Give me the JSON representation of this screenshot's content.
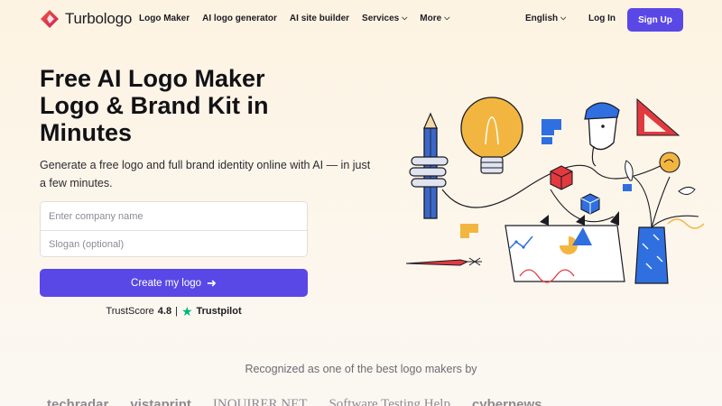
{
  "header": {
    "brand": "Turbologo",
    "nav": [
      {
        "label": "Logo Maker",
        "dropdown": false
      },
      {
        "label": "AI logo generator",
        "dropdown": false
      },
      {
        "label": "AI site builder",
        "dropdown": false
      },
      {
        "label": "Services",
        "dropdown": true
      },
      {
        "label": "More",
        "dropdown": true
      }
    ],
    "language": "English",
    "login": "Log In",
    "signup": "Sign Up"
  },
  "hero": {
    "title_lines": [
      "Free AI Logo Maker",
      "Logo & Brand Kit in",
      "Minutes"
    ],
    "subtitle": "Generate a free logo and full brand identity online with AI — in just a few minutes.",
    "company_placeholder": "Enter company name",
    "slogan_placeholder": "Slogan (optional)",
    "cta": "Create my logo",
    "trust_prefix": "TrustScore",
    "trust_score": "4.8",
    "trust_sep": "|",
    "trust_brand": "Trustpilot"
  },
  "recognized": {
    "heading": "Recognized as one of the best logo makers by",
    "brands": [
      "techradar",
      "vistaprint",
      "INQUIRER.NET",
      "Software Testing Help",
      "cybernews"
    ]
  },
  "colors": {
    "accent": "#5a48e6",
    "background": "#fdf3e2",
    "trustpilot": "#00b67a"
  },
  "icons": {
    "logo": "turbologo-mark-icon",
    "chevron": "chevron-down-icon",
    "cta_arrow": "arrow-right-icon",
    "trust_star": "trustpilot-star-icon"
  }
}
